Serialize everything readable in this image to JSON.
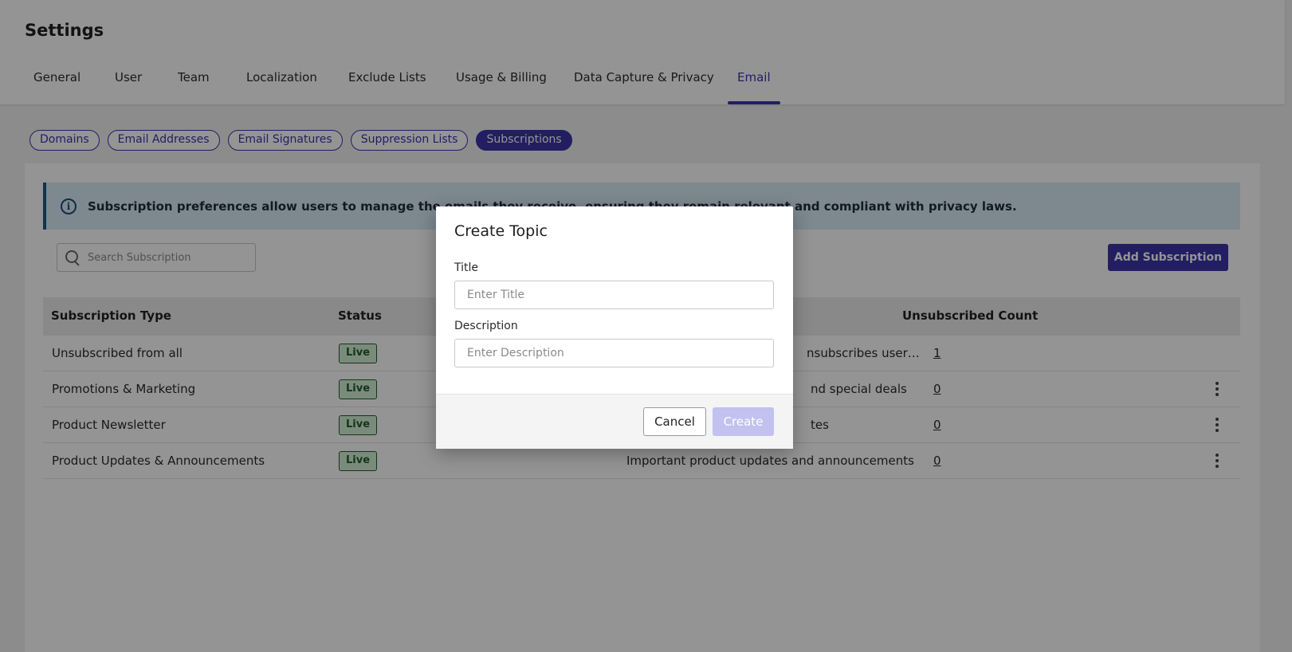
{
  "header": {
    "title": "Settings",
    "tabs": [
      {
        "label": "General"
      },
      {
        "label": "User"
      },
      {
        "label": "Team"
      },
      {
        "label": "Localization"
      },
      {
        "label": "Exclude Lists"
      },
      {
        "label": "Usage & Billing"
      },
      {
        "label": "Data Capture & Privacy"
      },
      {
        "label": "Email"
      }
    ],
    "active_tab": "Email"
  },
  "subtabs": {
    "items": [
      {
        "label": "Domains"
      },
      {
        "label": "Email Addresses"
      },
      {
        "label": "Email Signatures"
      },
      {
        "label": "Suppression Lists"
      },
      {
        "label": "Subscriptions"
      }
    ],
    "active": "Subscriptions"
  },
  "info": {
    "text": "Subscription preferences allow users to manage the emails they receive, ensuring they remain relevant and compliant with privacy laws.",
    "icon": "info-icon"
  },
  "search": {
    "placeholder": "Search Subscription",
    "value": ""
  },
  "add_button": "Add Subscription",
  "table": {
    "headers": {
      "type": "Subscription Type",
      "status": "Status",
      "count": "Unsubscribed Count"
    },
    "rows": [
      {
        "type": "Unsubscribed from all",
        "status": "Live",
        "description": "nsubscribes user…",
        "count": "1",
        "menu": false
      },
      {
        "type": "Promotions & Marketing",
        "status": "Live",
        "description": "nd special deals",
        "count": "0",
        "menu": true
      },
      {
        "type": "Product Newsletter",
        "status": "Live",
        "description": "tes",
        "count": "0",
        "menu": true
      },
      {
        "type": "Product Updates & Announcements",
        "status": "Live",
        "description": "Important product updates and announcements",
        "count": "0",
        "menu": true
      }
    ]
  },
  "modal": {
    "title": "Create Topic",
    "title_label": "Title",
    "title_placeholder": "Enter Title",
    "title_value": "",
    "description_label": "Description",
    "description_placeholder": "Enter Description",
    "description_value": "",
    "cancel": "Cancel",
    "create": "Create"
  },
  "colors": {
    "accent": "#3b35a8",
    "live_badge_bg": "#d3f0d6",
    "live_badge_fg": "#1f5e2a",
    "info_bg": "#d8eaf7",
    "create_disabled": "#c2c1f0"
  }
}
